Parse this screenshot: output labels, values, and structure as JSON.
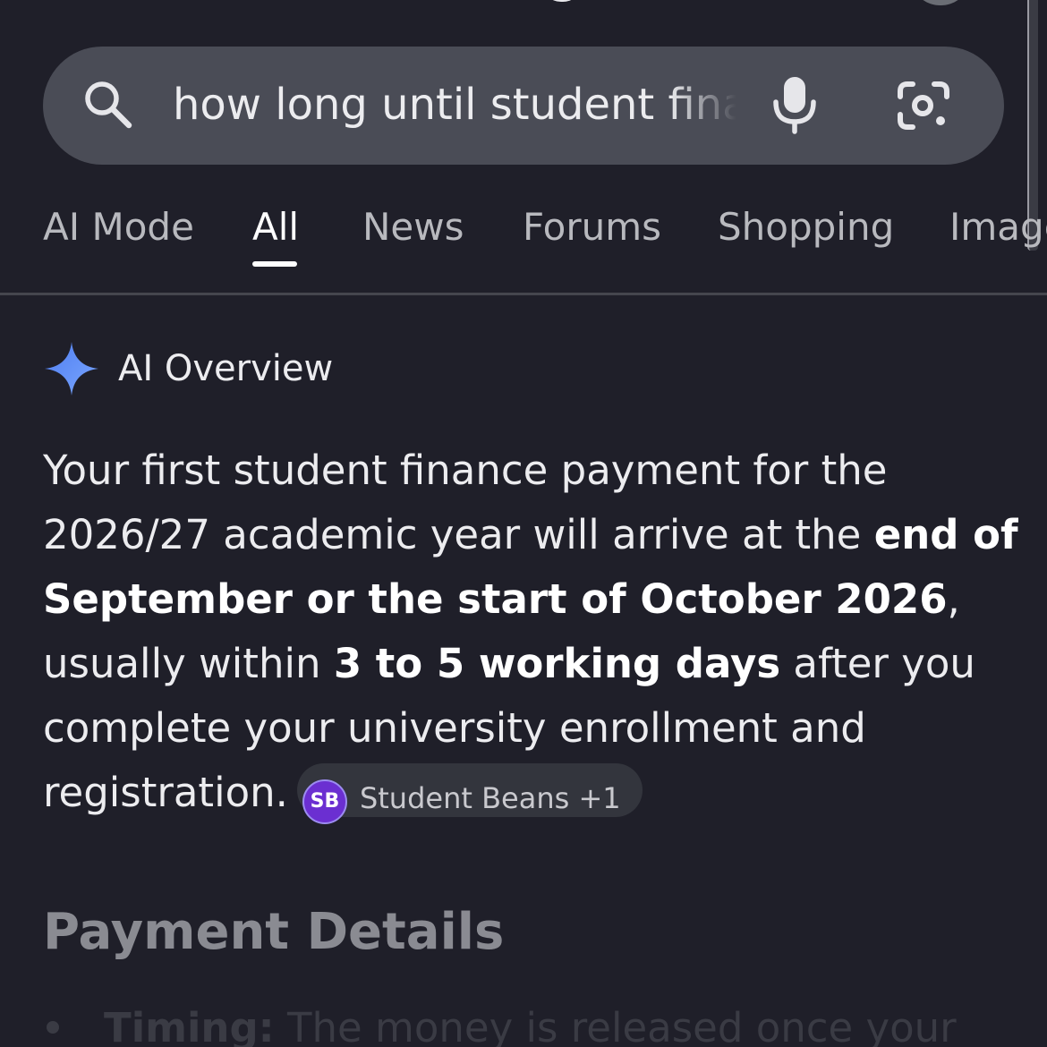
{
  "search": {
    "query": "how long until student finance payment",
    "icons": [
      "search-icon",
      "mic-icon",
      "google-lens-icon"
    ]
  },
  "tabs": [
    {
      "label": "AI Mode"
    },
    {
      "label": "All",
      "active": true
    },
    {
      "label": "News"
    },
    {
      "label": "Forums"
    },
    {
      "label": "Shopping"
    },
    {
      "label": "Images"
    }
  ],
  "ai_overview": {
    "title": "AI Overview",
    "text_1": "Your first student finance payment for the 2026/27 academic year will arrive at the ",
    "bold_1": "end of September or the start of October 2026",
    "text_2": ", usually within ",
    "bold_2": "3 to 5 working days",
    "text_3": " after you complete your university enrollment and registration.",
    "source_chip": {
      "badge": "SB",
      "label": "Student Beans +1"
    }
  },
  "payment_details": {
    "heading": "Payment Details",
    "first_item_label": "Timing:",
    "first_item_text": " The money is released once your"
  },
  "colors": {
    "background": "#1f1f29",
    "search_bar": "#4a4c56",
    "sparkle_blue": "#5b8ff0",
    "badge_purple": "#6b2fd1"
  }
}
